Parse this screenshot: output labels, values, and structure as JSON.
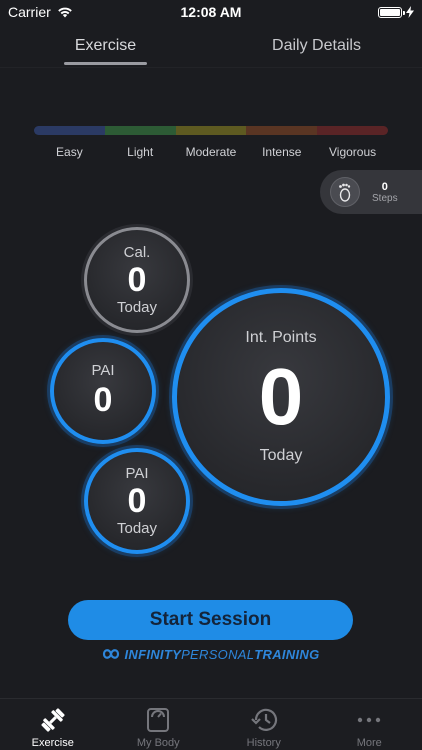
{
  "status_bar": {
    "carrier": "Carrier",
    "time": "12:08 AM"
  },
  "tabs": [
    {
      "label": "Exercise",
      "active": true
    },
    {
      "label": "Daily Details",
      "active": false
    }
  ],
  "zones": [
    {
      "label": "Easy",
      "color": "#2b3a64"
    },
    {
      "label": "Light",
      "color": "#2d5b35"
    },
    {
      "label": "Moderate",
      "color": "#5e5a21"
    },
    {
      "label": "Intense",
      "color": "#5a3523"
    },
    {
      "label": "Vigorous",
      "color": "#5a2426"
    }
  ],
  "steps": {
    "value": "0",
    "label": "Steps"
  },
  "metrics": {
    "calories": {
      "label": "Cal.",
      "value": "0",
      "sub": "Today"
    },
    "pai": {
      "label": "PAI",
      "value": "0"
    },
    "pai_today": {
      "label": "PAI",
      "value": "0",
      "sub": "Today"
    },
    "int_points": {
      "label": "Int. Points",
      "value": "0",
      "sub": "Today"
    }
  },
  "start_button": {
    "label": "Start Session"
  },
  "brand": {
    "part1": "INFINITY",
    "part2": "PERSONAL",
    "part3": "TRAINING"
  },
  "bottom_nav": [
    {
      "label": "Exercise",
      "icon": "dumbbell-icon",
      "active": true
    },
    {
      "label": "My Body",
      "icon": "scale-icon",
      "active": false
    },
    {
      "label": "History",
      "icon": "history-icon",
      "active": false
    },
    {
      "label": "More",
      "icon": "more-icon",
      "active": false
    }
  ],
  "colors": {
    "accent": "#1f8ce6",
    "background": "#1b1c20"
  }
}
